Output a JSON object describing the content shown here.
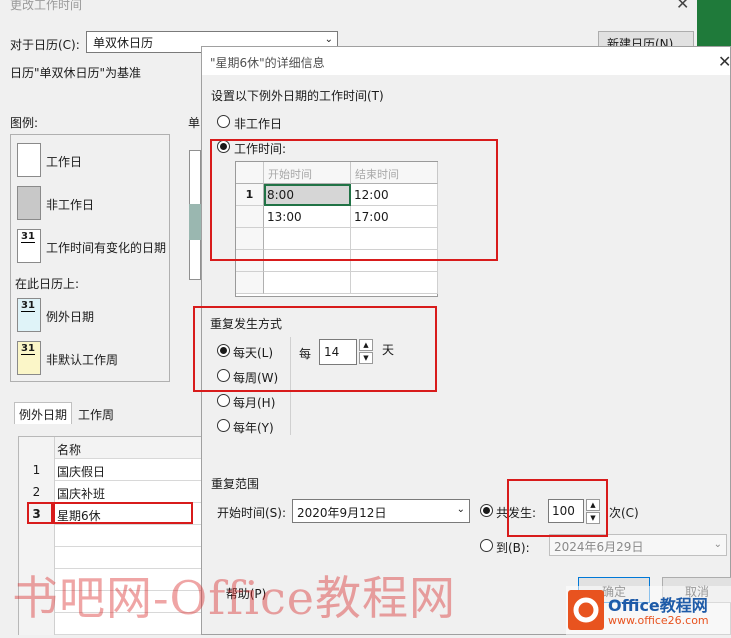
{
  "back": {
    "title": "更改工作时间",
    "for_calendar_label": "对于日历(C):",
    "calendar_value": "单双休日历",
    "new_calendar_button": "新建日历(N)...",
    "base_text": "日历\"单双休日历\"为基准",
    "legend_label": "图例:",
    "legend": {
      "working": "工作日",
      "nonworking": "非工作日",
      "changed": "工作时间有变化的日期",
      "on_this_calendar": "在此日历上:",
      "exception": "例外日期",
      "nondefault": "非默认工作周",
      "day_number": "31"
    },
    "mid_label": "单",
    "tabs": [
      "例外日期",
      "工作周"
    ],
    "table_header": "名称",
    "rows": [
      {
        "num": "1",
        "name": "国庆假日"
      },
      {
        "num": "2",
        "name": "国庆补班"
      },
      {
        "num": "3",
        "name": "星期6休"
      }
    ]
  },
  "detail": {
    "title": "\"星期6休\"的详细信息",
    "set_time_label": "设置以下例外日期的工作时间(T)",
    "option_nonworking": "非工作日",
    "option_working": "工作时间:",
    "grid": {
      "headers": [
        "开始时间",
        "结束时间"
      ],
      "rows": [
        {
          "num": "1",
          "start": "8:00",
          "end": "12:00"
        },
        {
          "num": "",
          "start": "13:00",
          "end": "17:00"
        },
        {
          "num": "",
          "start": "",
          "end": ""
        },
        {
          "num": "",
          "start": "",
          "end": ""
        },
        {
          "num": "",
          "start": "",
          "end": ""
        }
      ]
    },
    "recurrence_label": "重复发生方式",
    "frequencies": [
      "每天(L)",
      "每周(W)",
      "每月(H)",
      "每年(Y)"
    ],
    "selected_frequency": "每天(L)",
    "every_label": "每",
    "every_value": "14",
    "every_unit": "天",
    "range_label": "重复范围",
    "start_label": "开始时间(S):",
    "start_value": "2020年9月12日",
    "occurrences_label": "共发生:",
    "occurrences_value": "100",
    "times_label": "次(C)",
    "end_by_label": "到(B):",
    "end_by_value": "2024年6月29日",
    "help_button": "帮助(P)",
    "ok_button": "确定",
    "cancel_button": "取消"
  },
  "watermark": "书吧网-Office教程网",
  "logo": {
    "line1": "Office教程网",
    "line2": "www.office26.com"
  },
  "colors": {
    "highlight": "#d81b1b",
    "excel_green": "#217346",
    "logo_orange": "#e8531f",
    "logo_blue": "#1e5ba8"
  }
}
